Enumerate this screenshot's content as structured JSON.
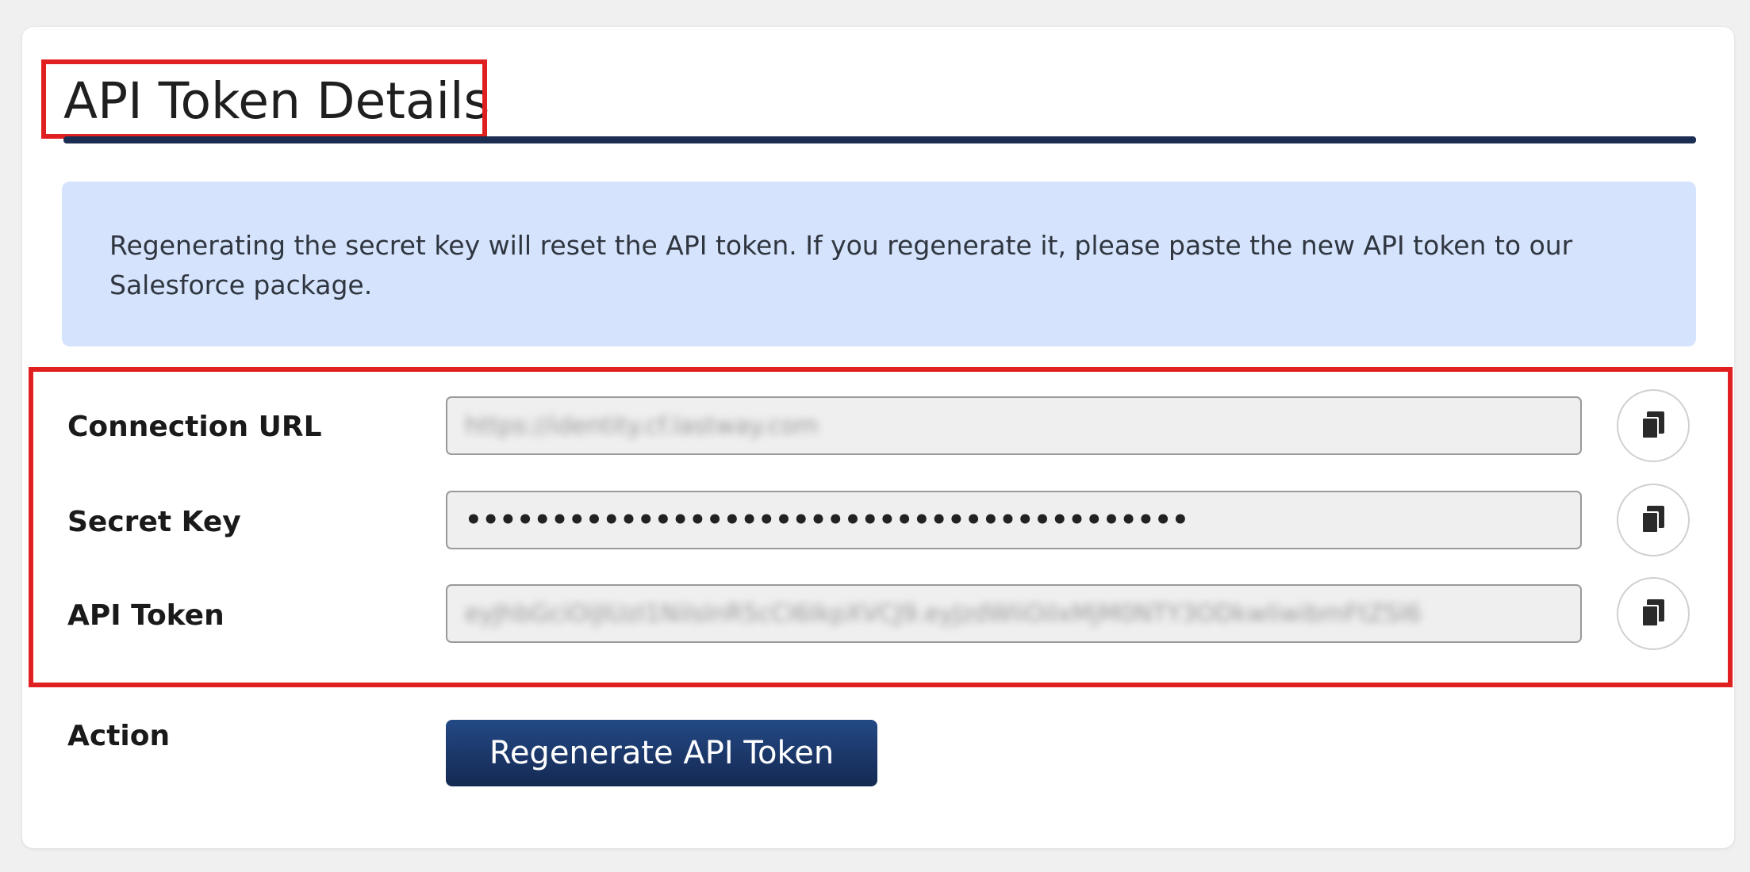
{
  "page": {
    "title": "API Token Details"
  },
  "info": {
    "text": "Regenerating the secret key will reset the API token. If you regenerate it, please paste the new API token to our Salesforce package."
  },
  "fields": {
    "connection_url": {
      "label": "Connection URL",
      "value": "https://identity.cf.lastway.com"
    },
    "secret_key": {
      "label": "Secret Key",
      "value": "••••••••••••••••••••••••••••••••••••••••••"
    },
    "api_token": {
      "label": "API Token",
      "value": "eyJhbGciOiJIUzI1NiIsInR5cCI6IkpXVCJ9.eyJzdWIiOiIxMjM0NTY3ODkwIiwibmFtZSI6"
    }
  },
  "action": {
    "label": "Action",
    "button_label": "Regenerate API Token"
  },
  "icons": {
    "copy": "copy-icon"
  },
  "colors": {
    "accent": "#1b2d52",
    "info_background": "#d5e3fc",
    "highlight": "#e02020",
    "button": "#1b3566"
  }
}
